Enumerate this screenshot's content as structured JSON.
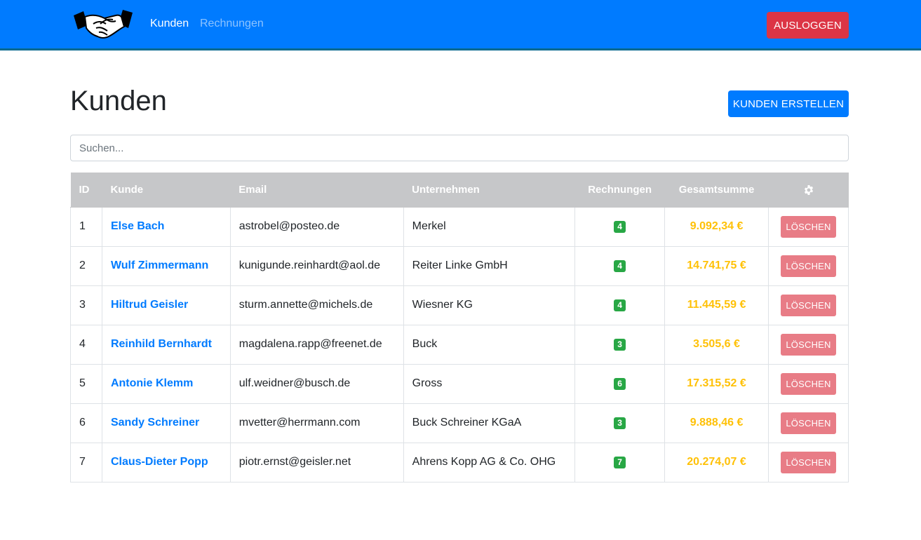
{
  "nav": {
    "links": [
      {
        "label": "Kunden",
        "active": true
      },
      {
        "label": "Rechnungen",
        "active": false
      }
    ],
    "logout_label": "AUSLOGGEN"
  },
  "page": {
    "title": "Kunden",
    "create_label": "KUNDEN ERSTELLEN",
    "search_placeholder": "Suchen..."
  },
  "table": {
    "headers": {
      "id": "ID",
      "kunde": "Kunde",
      "email": "Email",
      "unternehmen": "Unternehmen",
      "rechnungen": "Rechnungen",
      "gesamtsumme": "Gesamtsumme",
      "actions_icon": "gear-icon"
    },
    "delete_label": "LÖSCHEN",
    "rows": [
      {
        "id": "1",
        "name": "Else Bach",
        "email": "astrobel@posteo.de",
        "company": "Merkel",
        "invoices": "4",
        "total": "9.092,34 €"
      },
      {
        "id": "2",
        "name": "Wulf Zimmermann",
        "email": "kunigunde.reinhardt@aol.de",
        "company": "Reiter Linke GmbH",
        "invoices": "4",
        "total": "14.741,75 €"
      },
      {
        "id": "3",
        "name": "Hiltrud Geisler",
        "email": "sturm.annette@michels.de",
        "company": "Wiesner KG",
        "invoices": "4",
        "total": "11.445,59 €"
      },
      {
        "id": "4",
        "name": "Reinhild Bernhardt",
        "email": "magdalena.rapp@freenet.de",
        "company": "Buck",
        "invoices": "3",
        "total": "3.505,6 €"
      },
      {
        "id": "5",
        "name": "Antonie Klemm",
        "email": "ulf.weidner@busch.de",
        "company": "Gross",
        "invoices": "6",
        "total": "17.315,52 €"
      },
      {
        "id": "6",
        "name": "Sandy Schreiner",
        "email": "mvetter@herrmann.com",
        "company": "Buck Schreiner KGaA",
        "invoices": "3",
        "total": "9.888,46 €"
      },
      {
        "id": "7",
        "name": "Claus-Dieter Popp",
        "email": "piotr.ernst@geisler.net",
        "company": "Ahrens Kopp AG & Co. OHG",
        "invoices": "7",
        "total": "20.274,07 €"
      }
    ]
  },
  "colors": {
    "primary": "#007bff",
    "danger": "#dc3545",
    "success": "#28a745",
    "warning": "#ffc107",
    "header_gray": "#c6c7c9"
  }
}
